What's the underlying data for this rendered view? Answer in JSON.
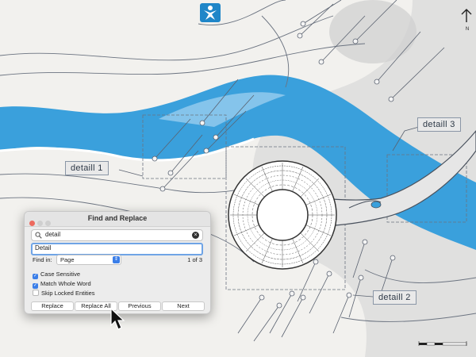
{
  "drawing": {
    "callouts": [
      {
        "id": "d1",
        "label": "detaill 1"
      },
      {
        "id": "d2",
        "label": "detaill 2"
      },
      {
        "id": "d3",
        "label": "detaill 3"
      }
    ],
    "compass_label": "N",
    "colors": {
      "water": "#3aa0dc",
      "water_light": "#8ec8ec",
      "land": "#f2f1ee",
      "shadow": "#cfcfcf",
      "line": "#5a6270"
    }
  },
  "dialog": {
    "title": "Find and Replace",
    "search": {
      "value": "detail"
    },
    "replace": {
      "value": "Detail"
    },
    "find_in": {
      "label": "Find in:",
      "value": "Page"
    },
    "match_count": "1 of 3",
    "options": [
      {
        "label": "Case Sensitive",
        "checked": true
      },
      {
        "label": "Match Whole Word",
        "checked": true
      },
      {
        "label": "Skip Locked Entities",
        "checked": false
      }
    ],
    "buttons": {
      "replace": "Replace",
      "replace_all": "Replace All",
      "previous": "Previous",
      "next": "Next"
    }
  },
  "app_logo": {
    "icon": "app-logo-icon",
    "color": "#1f86c8"
  }
}
